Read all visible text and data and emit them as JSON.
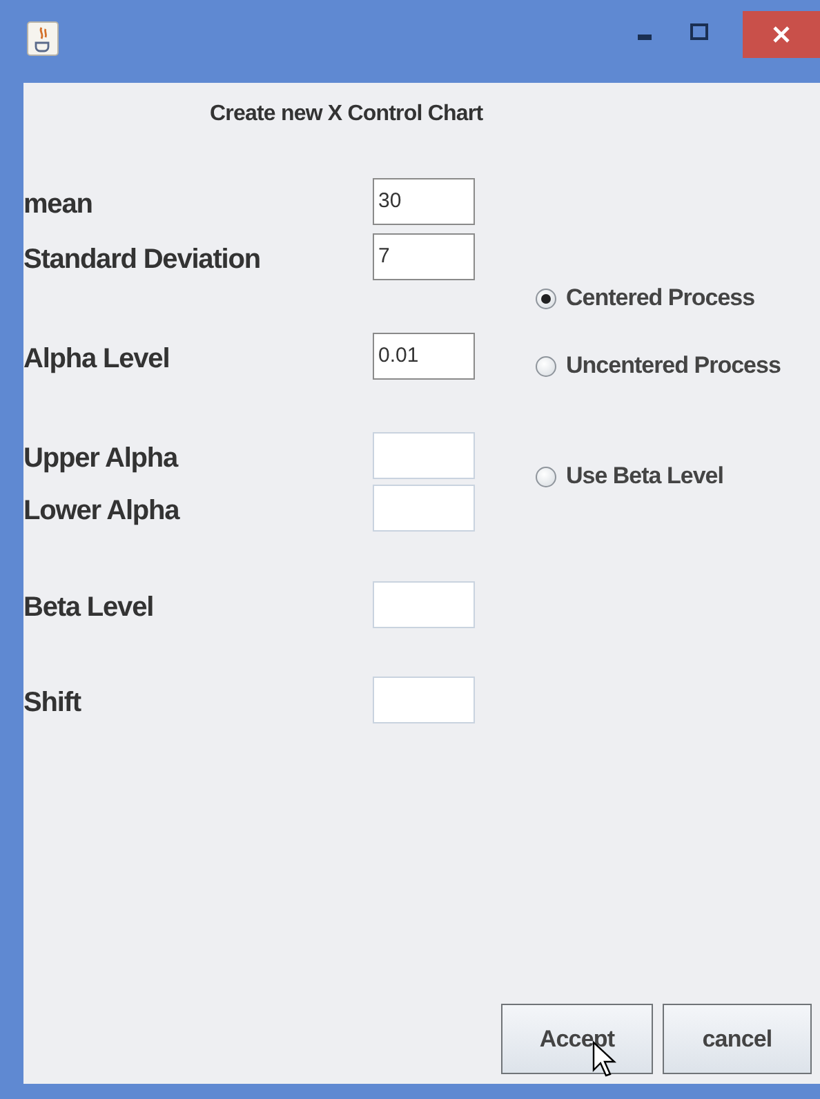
{
  "window": {
    "heading": "Create new X Control Chart"
  },
  "fields": [
    {
      "label": "mean",
      "value": "30"
    },
    {
      "label": "Standard Deviation",
      "value": "7"
    },
    {
      "label": "Alpha Level",
      "value": "0.01"
    },
    {
      "label": "Upper Alpha"
    },
    {
      "label": "Lower Alpha"
    },
    {
      "label": "Beta Level"
    },
    {
      "label": "Shift"
    }
  ],
  "options": [
    {
      "label": "Centered Process",
      "selected": true
    },
    {
      "label": "Uncentered Process",
      "selected": false
    },
    {
      "label": "Use Beta Level",
      "selected": false
    }
  ],
  "buttons": [
    "Accept",
    "cancel"
  ]
}
